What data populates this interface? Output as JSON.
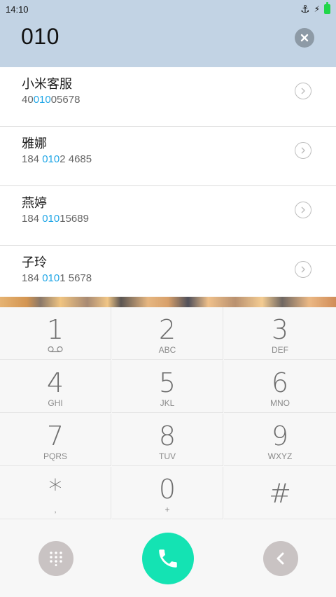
{
  "status_bar": {
    "time": "14:10"
  },
  "search": {
    "query": "010"
  },
  "results": [
    {
      "name": "小米客服",
      "number_pre": "40",
      "number_match": "010",
      "number_post": "05678"
    },
    {
      "name": "雅娜",
      "number_pre": "184 ",
      "number_match": "010",
      "number_post": "2 4685"
    },
    {
      "name": "燕婷",
      "number_pre": "184 ",
      "number_match": "010",
      "number_post": "15689"
    },
    {
      "name": "子玲",
      "number_pre": "184 ",
      "number_match": "010",
      "number_post": "1 5678"
    }
  ],
  "keys": [
    {
      "digit": "1",
      "sub": ""
    },
    {
      "digit": "2",
      "sub": "ABC"
    },
    {
      "digit": "3",
      "sub": "DEF"
    },
    {
      "digit": "4",
      "sub": "GHI"
    },
    {
      "digit": "5",
      "sub": "JKL"
    },
    {
      "digit": "6",
      "sub": "MNO"
    },
    {
      "digit": "7",
      "sub": "PQRS"
    },
    {
      "digit": "8",
      "sub": "TUV"
    },
    {
      "digit": "9",
      "sub": "WXYZ"
    },
    {
      "digit": "*",
      "sub": ","
    },
    {
      "digit": "0",
      "sub": "+"
    },
    {
      "digit": "#",
      "sub": ""
    }
  ],
  "icons": {
    "status": [
      "anchor-icon",
      "charging-bolt-icon",
      "battery-icon"
    ],
    "clear": "clear-x-icon",
    "row_action": "chevron-right-circle-icon",
    "dialpad": "dialpad-grid-icon",
    "call": "phone-icon",
    "back": "back-chevron-icon",
    "voicemail": "voicemail-icon"
  },
  "colors": {
    "header_bg": "#c2d3e4",
    "match_highlight": "#20a6e6",
    "call_button": "#14e3b3",
    "secondary_button": "#c9c3c3",
    "battery": "#21d64a"
  }
}
